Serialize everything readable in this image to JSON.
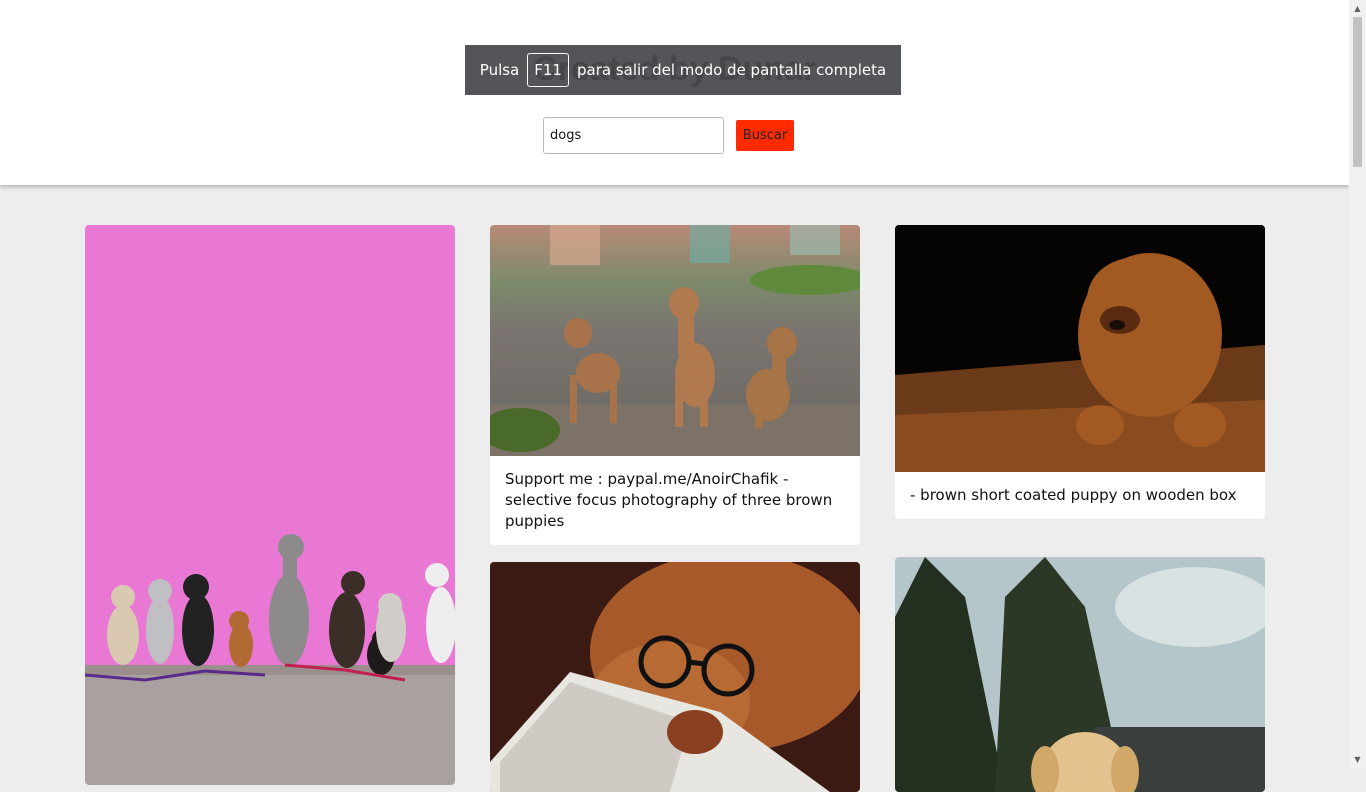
{
  "header": {
    "title": "Created by Dunar",
    "fullscreen_notice": {
      "before": "Pulsa",
      "key": "F11",
      "after": "para salir del modo de pantalla completa"
    },
    "search": {
      "value": "dogs",
      "button_label": "Buscar"
    }
  },
  "results": [
    {
      "caption": "",
      "alt": "group of dogs sitting in front of pink wall"
    },
    {
      "caption": "Support me : paypal.me/AnoirChafik - selective focus photography of three brown puppies",
      "alt": "three brown puppies"
    },
    {
      "caption": "- brown short coated puppy on wooden box",
      "alt": "brown puppy on wooden box"
    },
    {
      "caption": "",
      "alt": "dog wearing eyeglasses reading magazine"
    },
    {
      "caption": "",
      "alt": "golden puppy under cloudy sky"
    }
  ],
  "colors": {
    "accent": "#ff2a00",
    "page_background": "#ededed",
    "pink_wall": "#e878d4"
  }
}
